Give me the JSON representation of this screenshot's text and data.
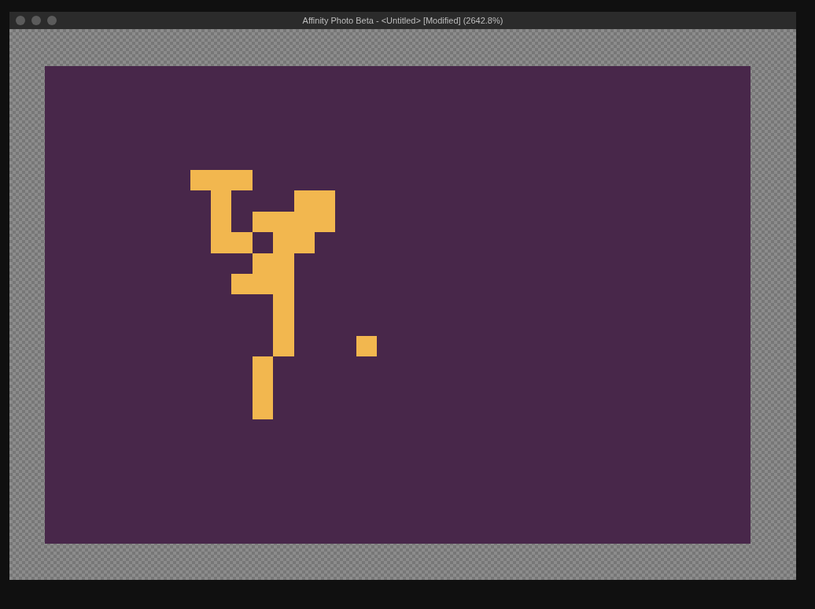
{
  "window": {
    "title": "Affinity Photo Beta - <Untitled> [Modified] (2642.8%)"
  }
}
